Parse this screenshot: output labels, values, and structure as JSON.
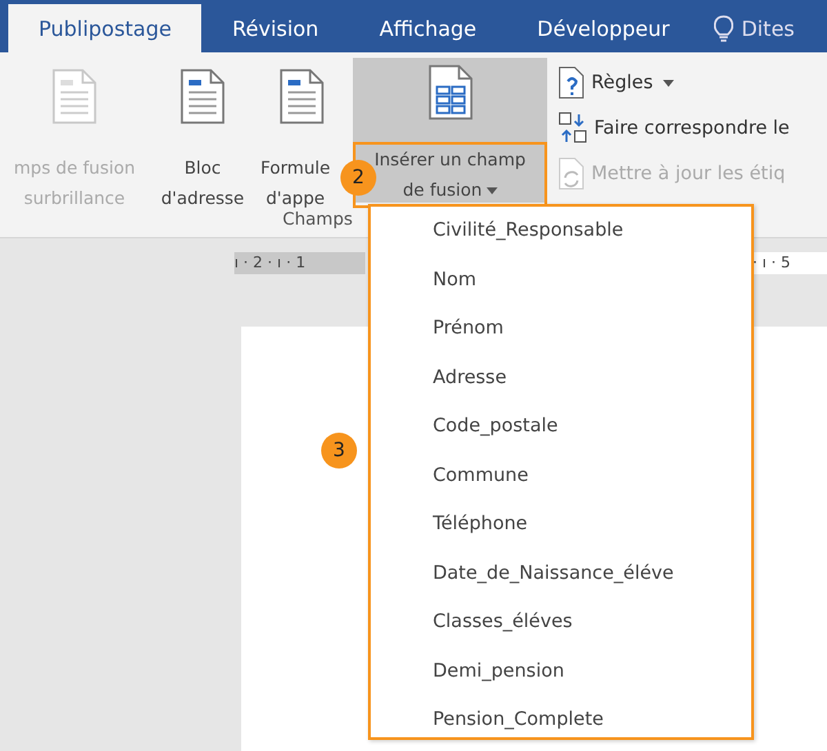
{
  "tabs": [
    {
      "label": "Publipostage",
      "selected": true
    },
    {
      "label": "Révision",
      "selected": false
    },
    {
      "label": "Affichage",
      "selected": false
    },
    {
      "label": "Développeur",
      "selected": false
    }
  ],
  "tell_me": {
    "label": "Dites"
  },
  "ribbon": {
    "large_buttons": [
      {
        "lines": [
          "mps de fusion",
          "surbrillance"
        ],
        "disabled": true
      },
      {
        "lines": [
          "Bloc",
          "d'adresse"
        ],
        "disabled": false
      },
      {
        "lines": [
          "Formule",
          "d'appe"
        ],
        "disabled": false
      }
    ],
    "insert_button": {
      "lines": [
        "Insérer un champ",
        "de fusion"
      ],
      "expanded": true
    },
    "small_buttons": [
      {
        "label": "Règles",
        "dropdown": true,
        "disabled": false
      },
      {
        "label": "Faire correspondre le",
        "dropdown": false,
        "disabled": false
      },
      {
        "label": "Mettre à jour les étiq",
        "dropdown": false,
        "disabled": true
      }
    ],
    "group_label": "Champs"
  },
  "ruler": {
    "left": "ı · 2 · ı · 1",
    "right": "· ı · 5"
  },
  "menu": {
    "items": [
      "Civilité_Responsable",
      "Nom",
      "Prénom",
      "Adresse",
      "Code_postale",
      "Commune",
      "Téléphone",
      "Date_de_Naissance_éléve",
      "Classes_éléves",
      "Demi_pension",
      "Pension_Complete"
    ]
  },
  "annotations": [
    {
      "label": "2"
    },
    {
      "label": "3"
    }
  ]
}
